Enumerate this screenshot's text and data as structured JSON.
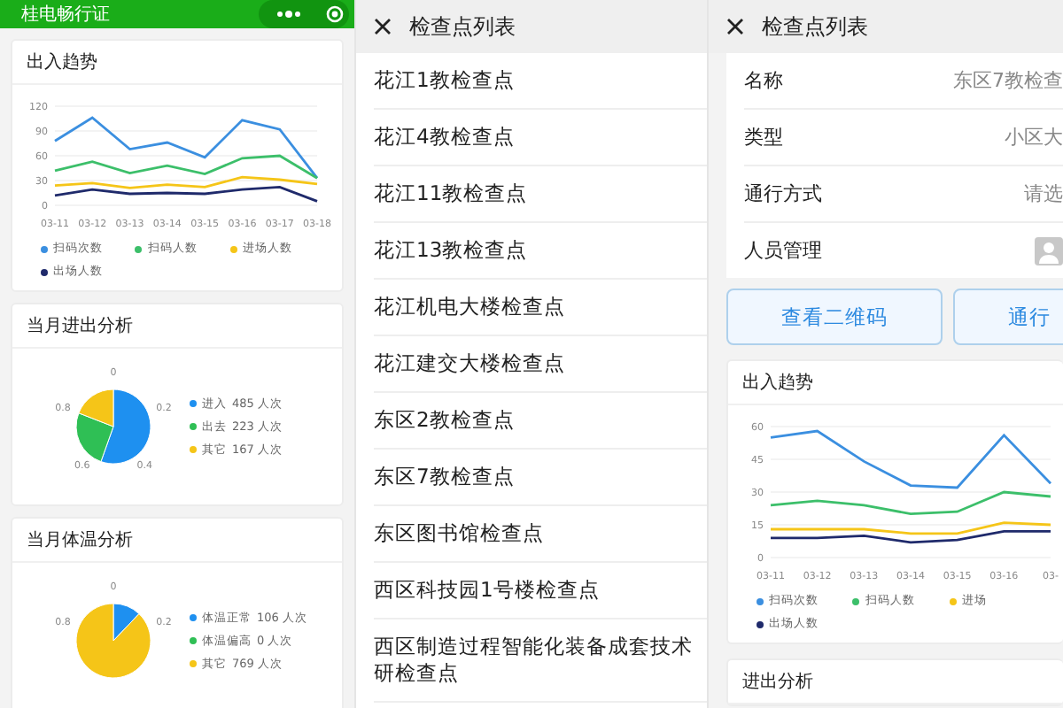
{
  "pass_app": {
    "title": "桂电畅行证",
    "trend_card": {
      "title": "出入趋势",
      "chart_data": {
        "type": "line",
        "grid": true,
        "categories": [
          "03-11",
          "03-12",
          "03-13",
          "03-14",
          "03-15",
          "03-16",
          "03-17",
          "03-18"
        ],
        "ylim": [
          0,
          120
        ],
        "yticks": [
          0,
          30,
          60,
          90,
          120
        ],
        "series": [
          {
            "name": "扫码次数",
            "color": "#3b8fe0",
            "values": [
              78,
              106,
              68,
              76,
              58,
              103,
              92,
              33
            ]
          },
          {
            "name": "扫码人数",
            "color": "#3cbf6a",
            "values": [
              42,
              53,
              39,
              48,
              38,
              57,
              60,
              33
            ]
          },
          {
            "name": "进场人数",
            "color": "#f5c518",
            "values": [
              24,
              27,
              21,
              25,
              22,
              34,
              31,
              26
            ]
          },
          {
            "name": "出场人数",
            "color": "#1f2a6b",
            "values": [
              12,
              19,
              14,
              15,
              14,
              19,
              22,
              5
            ]
          }
        ]
      }
    },
    "pie_cards": [
      {
        "title": "当月进出分析",
        "ring_labels": [
          "0",
          "0.2",
          "0.4",
          "0.6",
          "0.8"
        ],
        "chart_data": {
          "type": "pie",
          "categories": [
            "进入",
            "出去",
            "其它"
          ],
          "values": [
            55.43,
            25.49,
            19.08
          ]
        },
        "legend": [
          {
            "count": "485 人次",
            "color": "#1e90f0"
          },
          {
            "count": "223 人次",
            "color": "#2fbf55"
          },
          {
            "count": "167 人次",
            "color": "#f5c518"
          }
        ]
      },
      {
        "title": "当月体温分析",
        "ring_labels": [
          "0",
          "0.2",
          "0.8"
        ],
        "chart_data": {
          "type": "pie",
          "categories": [
            "体温正常",
            "体温偏高",
            "其它"
          ],
          "values": [
            12.11,
            0,
            87.89
          ]
        },
        "legend": [
          {
            "count": "106 人次",
            "color": "#1e90f0"
          },
          {
            "count": "0 人次",
            "color": "#2fbf55"
          },
          {
            "count": "769 人次",
            "color": "#f5c518"
          }
        ]
      }
    ]
  },
  "checkpoint_list": {
    "title": "检查点列表",
    "items": [
      "花江1教检查点",
      "花江4教检查点",
      "花江11教检查点",
      "花江13教检查点",
      "花江机电大楼检查点",
      "花江建交大楼检查点",
      "东区2教检查点",
      "东区7教检查点",
      "东区图书馆检查点",
      "西区科技园1号楼检查点",
      "西区制造过程智能化装备成套技术研检查点"
    ]
  },
  "checkpoint_detail": {
    "title": "检查点列表",
    "fields": [
      {
        "kind": "text",
        "label": "名称",
        "value": "东区7教检查"
      },
      {
        "kind": "text",
        "label": "类型",
        "value": "小区大"
      },
      {
        "kind": "text",
        "label": "通行方式",
        "value": "请选"
      },
      {
        "kind": "avatar",
        "label": "人员管理"
      }
    ],
    "buttons": [
      "查看二维码",
      "通行"
    ],
    "trend_card": {
      "title": "出入趋势",
      "chart_data": {
        "type": "line",
        "grid": true,
        "categories": [
          "03-11",
          "03-12",
          "03-13",
          "03-14",
          "03-15",
          "03-16",
          "03-"
        ],
        "ylim": [
          0,
          60
        ],
        "yticks": [
          0,
          15,
          30,
          45,
          60
        ],
        "series": [
          {
            "name": "扫码次数",
            "color": "#3b8fe0",
            "values": [
              55,
              58,
              44,
              33,
              32,
              56,
              34
            ]
          },
          {
            "name": "扫码人数",
            "color": "#3cbf6a",
            "values": [
              24,
              26,
              24,
              20,
              21,
              30,
              28
            ]
          },
          {
            "name": "进场",
            "color": "#f5c518",
            "values": [
              13,
              13,
              13,
              11,
              11,
              16,
              15
            ]
          },
          {
            "name": "出场人数",
            "color": "#1f2a6b",
            "values": [
              9,
              9,
              10,
              7,
              8,
              12,
              12
            ]
          }
        ]
      }
    },
    "next_card_title": "进出分析"
  }
}
